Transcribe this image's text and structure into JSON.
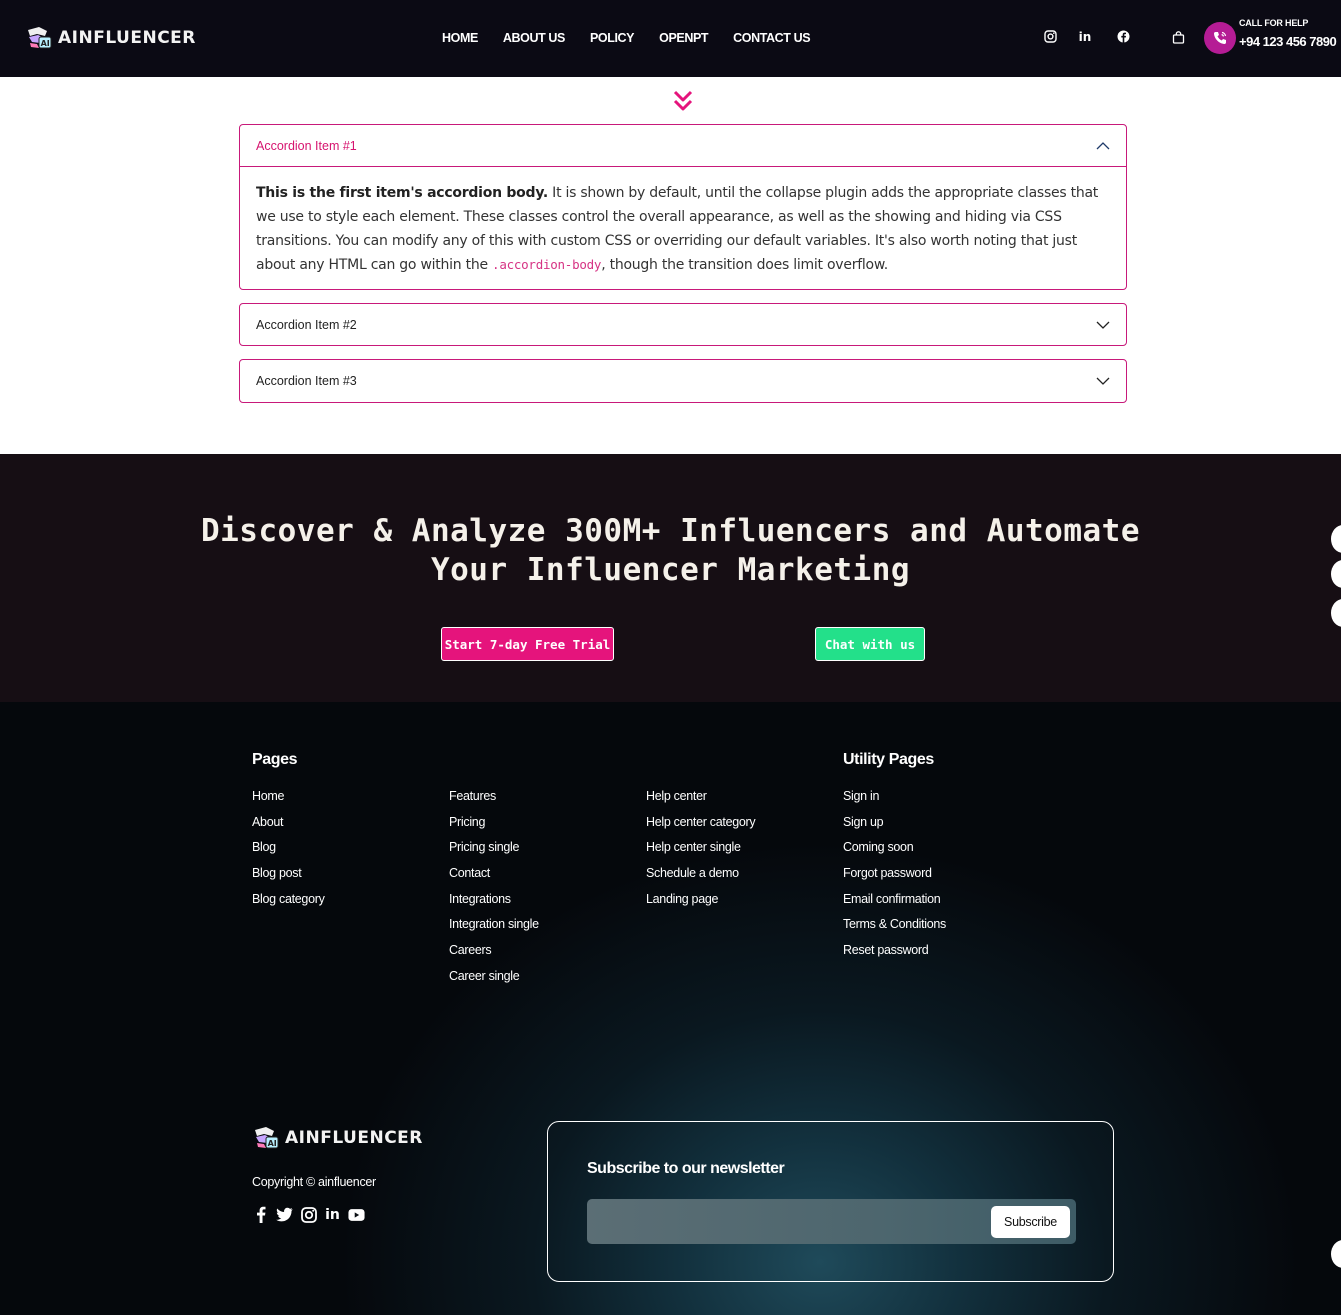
{
  "header": {
    "brand": "AINFLUENCER",
    "nav": [
      "HOME",
      "ABOUT US",
      "POLICY",
      "OPENPT",
      "CONTACT US"
    ],
    "social_icons": [
      "instagram-icon",
      "linkedin-icon",
      "facebook-icon"
    ],
    "cart_icon": "shopping-bag-icon",
    "call_label": "CALL FOR HELP",
    "call_number": "+94 123 456 7890"
  },
  "accordion": {
    "items": [
      {
        "title": "Accordion Item #1",
        "open": true
      },
      {
        "title": "Accordion Item #2",
        "open": false
      },
      {
        "title": "Accordion Item #3",
        "open": false
      }
    ],
    "body_strong": "This is the first item's accordion body.",
    "body_text_1": " It is shown by default, until the collapse plugin adds the appropriate classes that we use to style each element. These classes control the overall appearance, as well as the showing and hiding via CSS transitions. You can modify any of this with custom CSS or overriding our default variables. It's also worth noting that just about any HTML can go within the ",
    "body_code": ".accordion-body",
    "body_text_2": ", though the transition does limit overflow."
  },
  "cta": {
    "title_line1": "Discover & Analyze 300M+ Influencers and Automate",
    "title_line2": "Your Influencer Marketing",
    "trial_button": "Start 7-day Free Trial",
    "chat_button": "Chat with us",
    "colors": {
      "trial": "#e5147c",
      "chat": "#23e08a"
    }
  },
  "footer": {
    "pages_heading": "Pages",
    "utility_heading": "Utility Pages",
    "col1": [
      "Home",
      "About",
      "Blog",
      "Blog post",
      "Blog category"
    ],
    "col2": [
      "Features",
      "Pricing",
      "Pricing single",
      "Contact",
      "Integrations",
      "Integration single",
      "Careers",
      "Career single"
    ],
    "col3": [
      "Help center",
      "Help center category",
      "Help center single",
      "Schedule a demo",
      "Landing page"
    ],
    "col4": [
      "Sign in",
      "Sign up",
      "Coming soon",
      "Forgot password",
      "Email confirmation",
      "Terms & Conditions",
      "Reset password"
    ],
    "brand": "AINFLUENCER",
    "copyright": "Copyright © ainfluencer",
    "social_icons": [
      "facebook-icon",
      "twitter-icon",
      "instagram-icon",
      "linkedin-icon",
      "youtube-icon"
    ],
    "newsletter_title": "Subscribe to our newsletter",
    "subscribe_button": "Subscribe"
  }
}
